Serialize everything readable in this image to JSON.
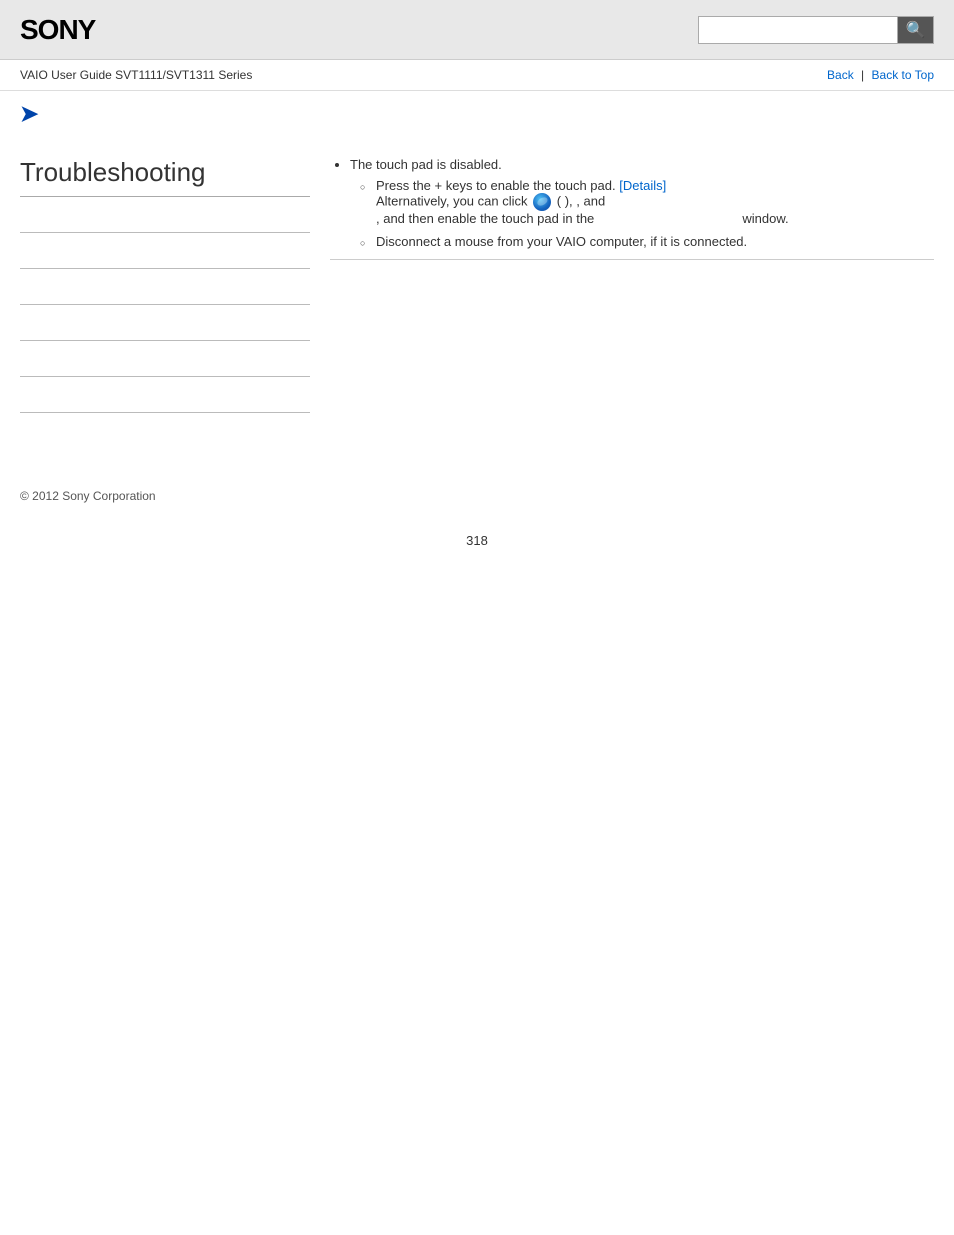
{
  "header": {
    "logo": "SONY",
    "search_placeholder": "",
    "search_icon": "🔍"
  },
  "breadcrumb": {
    "guide_title": "VAIO User Guide SVT1111/SVT1311 Series",
    "back_label": "Back",
    "separator": "|",
    "back_to_top_label": "Back to Top"
  },
  "sidebar": {
    "title": "Troubleshooting",
    "nav_items": [
      {
        "label": "",
        "id": "item1"
      },
      {
        "label": "",
        "id": "item2"
      },
      {
        "label": "",
        "id": "item3"
      },
      {
        "label": "",
        "id": "item4"
      },
      {
        "label": "",
        "id": "item5"
      },
      {
        "label": "",
        "id": "item6"
      },
      {
        "label": "",
        "id": "item7"
      }
    ]
  },
  "content": {
    "bullet_1": "The touch pad is disabled.",
    "sub_item_1_prefix": "Press the",
    "sub_item_1_keys": "  +  ",
    "sub_item_1_suffix": "keys to enable the touch pad.",
    "sub_item_1_link": "[Details]",
    "sub_item_1_alt_prefix": "Alternatively, you can click",
    "sub_item_1_alt_mid": "(        ),",
    "sub_item_1_alt_and": ", and",
    "sub_item_1_alt_suffix": ", and then enable the touch pad in the",
    "sub_item_1_alt_end": "window.",
    "sub_item_2": "Disconnect a mouse from your VAIO computer, if it is connected."
  },
  "footer": {
    "copyright": "© 2012 Sony Corporation"
  },
  "page_number": "318"
}
